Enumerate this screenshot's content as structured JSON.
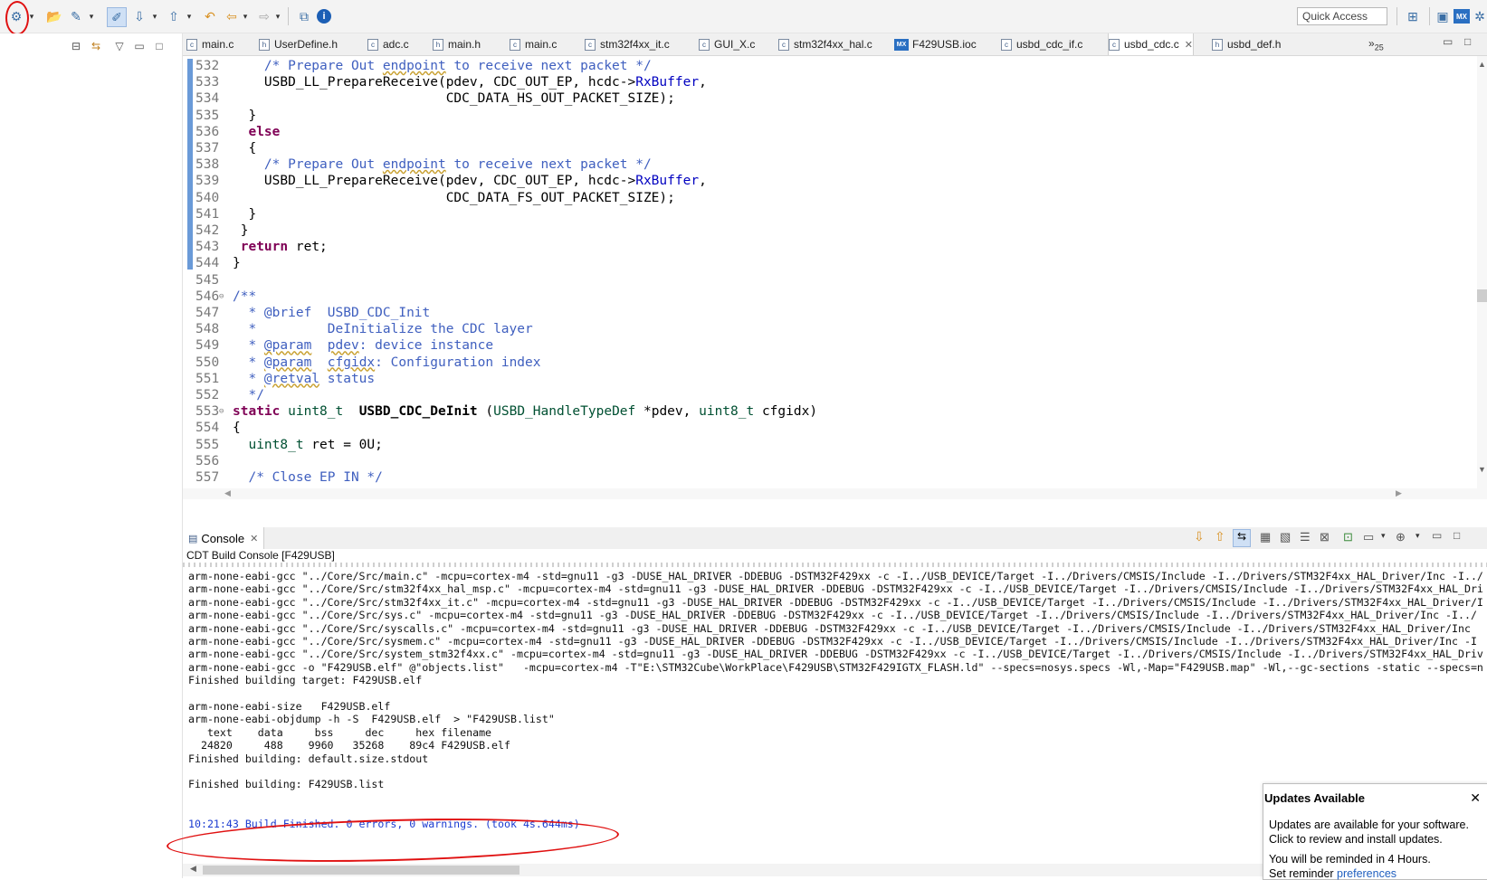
{
  "toolbar": {
    "quick_access_placeholder": "Quick Access",
    "icons": [
      "build-icon",
      "open-icon",
      "wand-icon",
      "highlight-icon",
      "next-annotation-icon",
      "prev-annotation-icon",
      "back-icon",
      "forward-icon",
      "new-window-icon",
      "info-icon"
    ]
  },
  "editor": {
    "tabs": [
      {
        "label": "main.c",
        "type": "c"
      },
      {
        "label": "UserDefine.h",
        "type": "h"
      },
      {
        "label": "adc.c",
        "type": "c"
      },
      {
        "label": "main.h",
        "type": "h"
      },
      {
        "label": "main.c",
        "type": "c"
      },
      {
        "label": "stm32f4xx_it.c",
        "type": "c"
      },
      {
        "label": "GUI_X.c",
        "type": "c"
      },
      {
        "label": "stm32f4xx_hal.c",
        "type": "c"
      },
      {
        "label": "F429USB.ioc",
        "type": "mx"
      },
      {
        "label": "usbd_cdc_if.c",
        "type": "c"
      },
      {
        "label": "usbd_cdc.c",
        "type": "c",
        "active": true
      },
      {
        "label": "usbd_def.h",
        "type": "h"
      }
    ],
    "overflow_count": "25",
    "lines": [
      {
        "n": "532",
        "segs": [
          [
            "    ",
            ""
          ],
          [
            "/* Prepare Out ",
            "cm"
          ],
          [
            "endpoint",
            "cm sq"
          ],
          [
            " to receive next packet */",
            "cm"
          ]
        ]
      },
      {
        "n": "533",
        "segs": [
          [
            "    USBD_LL_PrepareReceive(pdev, CDC_OUT_EP, hcdc->",
            ""
          ],
          [
            "RxBuffer",
            "fld"
          ],
          [
            ",",
            ""
          ]
        ]
      },
      {
        "n": "534",
        "segs": [
          [
            "                           CDC_DATA_HS_OUT_PACKET_SIZE);",
            ""
          ]
        ]
      },
      {
        "n": "535",
        "segs": [
          [
            "  }",
            ""
          ]
        ]
      },
      {
        "n": "536",
        "segs": [
          [
            "  ",
            ""
          ],
          [
            "else",
            "kw"
          ]
        ]
      },
      {
        "n": "537",
        "segs": [
          [
            "  {",
            ""
          ]
        ]
      },
      {
        "n": "538",
        "segs": [
          [
            "    ",
            ""
          ],
          [
            "/* Prepare Out ",
            "cm"
          ],
          [
            "endpoint",
            "cm sq"
          ],
          [
            " to receive next packet */",
            "cm"
          ]
        ]
      },
      {
        "n": "539",
        "segs": [
          [
            "    USBD_LL_PrepareReceive(pdev, CDC_OUT_EP, hcdc->",
            ""
          ],
          [
            "RxBuffer",
            "fld"
          ],
          [
            ",",
            ""
          ]
        ]
      },
      {
        "n": "540",
        "segs": [
          [
            "                           CDC_DATA_FS_OUT_PACKET_SIZE);",
            ""
          ]
        ]
      },
      {
        "n": "541",
        "segs": [
          [
            "  }",
            ""
          ]
        ]
      },
      {
        "n": "542",
        "segs": [
          [
            " }",
            ""
          ]
        ]
      },
      {
        "n": "543",
        "segs": [
          [
            " ",
            ""
          ],
          [
            "return",
            "kw"
          ],
          [
            " ret;",
            ""
          ]
        ]
      },
      {
        "n": "544",
        "segs": [
          [
            "}",
            ""
          ]
        ]
      },
      {
        "n": "545",
        "segs": [
          [
            "",
            ""
          ]
        ]
      },
      {
        "n": "546",
        "fold": true,
        "segs": [
          [
            "/**",
            "cm"
          ]
        ]
      },
      {
        "n": "547",
        "segs": [
          [
            "  * ",
            "cm"
          ],
          [
            "@brief",
            "cm"
          ],
          [
            "  USBD_CDC_Init",
            "cm"
          ]
        ]
      },
      {
        "n": "548",
        "segs": [
          [
            "  *         DeInitialize the CDC layer",
            "cm"
          ]
        ]
      },
      {
        "n": "549",
        "segs": [
          [
            "  * ",
            "cm"
          ],
          [
            "@param",
            "cm sq"
          ],
          [
            "  ",
            "cm"
          ],
          [
            "pdev",
            "cm sq"
          ],
          [
            ": device instance",
            "cm"
          ]
        ]
      },
      {
        "n": "550",
        "segs": [
          [
            "  * ",
            "cm"
          ],
          [
            "@param",
            "cm sq"
          ],
          [
            "  ",
            "cm"
          ],
          [
            "cfgidx",
            "cm sq"
          ],
          [
            ": Configuration index",
            "cm"
          ]
        ]
      },
      {
        "n": "551",
        "segs": [
          [
            "  * ",
            "cm"
          ],
          [
            "@retval",
            "cm sq"
          ],
          [
            " status",
            "cm"
          ]
        ]
      },
      {
        "n": "552",
        "segs": [
          [
            "  */",
            "cm"
          ]
        ]
      },
      {
        "n": "553",
        "fold": true,
        "segs": [
          [
            "static",
            "kw"
          ],
          [
            " ",
            ""
          ],
          [
            "uint8_t",
            "typ"
          ],
          [
            "  ",
            ""
          ],
          [
            "USBD_CDC_DeInit",
            "fn-bold"
          ],
          [
            " (",
            ""
          ],
          [
            "USBD_HandleTypeDef",
            "typ"
          ],
          [
            " *pdev, ",
            ""
          ],
          [
            "uint8_t",
            "typ"
          ],
          [
            " cfgidx)",
            ""
          ]
        ]
      },
      {
        "n": "554",
        "segs": [
          [
            "{",
            ""
          ]
        ]
      },
      {
        "n": "555",
        "segs": [
          [
            "  ",
            ""
          ],
          [
            "uint8_t",
            "typ"
          ],
          [
            " ret = 0U;",
            ""
          ]
        ]
      },
      {
        "n": "556",
        "segs": [
          [
            "",
            ""
          ]
        ]
      },
      {
        "n": "557",
        "segs": [
          [
            "  ",
            ""
          ],
          [
            "/* Close EP IN */",
            "cm"
          ]
        ]
      }
    ]
  },
  "console": {
    "tab_label": "Console",
    "title": "CDT Build Console [F429USB]",
    "lines": [
      {
        "t": "arm-none-eabi-gcc \"../Core/Src/main.c\" -mcpu=cortex-m4 -std=gnu11 -g3 -DUSE_HAL_DRIVER -DDEBUG -DSTM32F429xx -c -I../USB_DEVICE/Target -I../Drivers/CMSIS/Include -I../Drivers/STM32F4xx_HAL_Driver/Inc -I../"
      },
      {
        "t": "arm-none-eabi-gcc \"../Core/Src/stm32f4xx_hal_msp.c\" -mcpu=cortex-m4 -std=gnu11 -g3 -DUSE_HAL_DRIVER -DDEBUG -DSTM32F429xx -c -I../USB_DEVICE/Target -I../Drivers/CMSIS/Include -I../Drivers/STM32F4xx_HAL_Dri"
      },
      {
        "t": "arm-none-eabi-gcc \"../Core/Src/stm32f4xx_it.c\" -mcpu=cortex-m4 -std=gnu11 -g3 -DUSE_HAL_DRIVER -DDEBUG -DSTM32F429xx -c -I../USB_DEVICE/Target -I../Drivers/CMSIS/Include -I../Drivers/STM32F4xx_HAL_Driver/I"
      },
      {
        "t": "arm-none-eabi-gcc \"../Core/Src/sys.c\" -mcpu=cortex-m4 -std=gnu11 -g3 -DUSE_HAL_DRIVER -DDEBUG -DSTM32F429xx -c -I../USB_DEVICE/Target -I../Drivers/CMSIS/Include -I../Drivers/STM32F4xx_HAL_Driver/Inc -I../"
      },
      {
        "t": "arm-none-eabi-gcc \"../Core/Src/syscalls.c\" -mcpu=cortex-m4 -std=gnu11 -g3 -DUSE_HAL_DRIVER -DDEBUG -DSTM32F429xx -c -I../USB_DEVICE/Target -I../Drivers/CMSIS/Include -I../Drivers/STM32F4xx_HAL_Driver/Inc"
      },
      {
        "t": "arm-none-eabi-gcc \"../Core/Src/sysmem.c\" -mcpu=cortex-m4 -std=gnu11 -g3 -DUSE_HAL_DRIVER -DDEBUG -DSTM32F429xx -c -I../USB_DEVICE/Target -I../Drivers/CMSIS/Include -I../Drivers/STM32F4xx_HAL_Driver/Inc -I"
      },
      {
        "t": "arm-none-eabi-gcc \"../Core/Src/system_stm32f4xx.c\" -mcpu=cortex-m4 -std=gnu11 -g3 -DUSE_HAL_DRIVER -DDEBUG -DSTM32F429xx -c -I../USB_DEVICE/Target -I../Drivers/CMSIS/Include -I../Drivers/STM32F4xx_HAL_Driv"
      },
      {
        "t": "arm-none-eabi-gcc -o \"F429USB.elf\" @\"objects.list\"   -mcpu=cortex-m4 -T\"E:\\STM32Cube\\WorkPlace\\F429USB\\STM32F429IGTX_FLASH.ld\" --specs=nosys.specs -Wl,-Map=\"F429USB.map\" -Wl,--gc-sections -static --specs=n"
      },
      {
        "t": "Finished building target: F429USB.elf"
      },
      {
        "t": ""
      },
      {
        "t": "arm-none-eabi-size   F429USB.elf"
      },
      {
        "t": "arm-none-eabi-objdump -h -S  F429USB.elf  > \"F429USB.list\""
      },
      {
        "t": "   text    data     bss     dec     hex filename"
      },
      {
        "t": "  24820     488    9960   35268    89c4 F429USB.elf"
      },
      {
        "t": "Finished building: default.size.stdout"
      },
      {
        "t": ""
      },
      {
        "t": "Finished building: F429USB.list"
      },
      {
        "t": ""
      },
      {
        "t": ""
      },
      {
        "t": "10:21:43 Build Finished. 0 errors, 0 warnings. (took 4s.644ms)",
        "blue": true
      }
    ]
  },
  "updates_popup": {
    "title": "Updates Available",
    "line1": "Updates are available for your software.",
    "line2": "Click to review and install updates.",
    "line3": "You will be reminded in 4 Hours.",
    "line4_prefix": "Set reminder ",
    "line4_link": "preferences"
  },
  "colors": {
    "keyword": "#7f0055",
    "comment": "#3f5fbf",
    "field": "#0000c0",
    "annotation": "#e01010"
  }
}
